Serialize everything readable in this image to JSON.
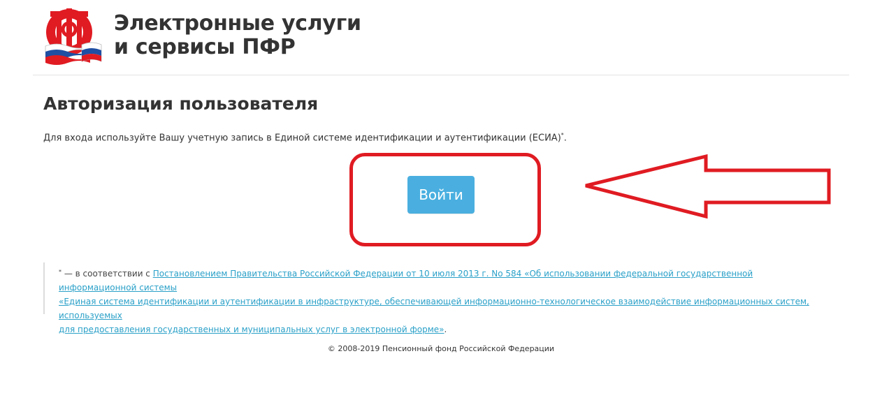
{
  "header": {
    "logo_alt": "ПФР",
    "title_line1": "Электронные услуги",
    "title_line2": "и сервисы ПФР"
  },
  "main": {
    "title": "Авторизация пользователя",
    "intro_text": "Для входа используйте Вашу учетную запись в Единой системе идентификации и аутентификации (ЕСИА)",
    "intro_mark": "*",
    "intro_end": ".",
    "login_button_label": "Войти"
  },
  "footnote": {
    "marker": "*",
    "prefix": " — в соответствии с ",
    "link_line1": "Постановлением Правительства Российской Федерации от 10 июля 2013 г. No 584 «Об использовании федеральной государственной информационной системы",
    "link_line2": "«Единая система идентификации и аутентификации в инфраструктуре, обеспечивающей информационно-технологическое взаимодействие информационных систем, используемых",
    "link_line3": "для предоставления государственных и муниципальных услуг в электронной форме»",
    "suffix": "."
  },
  "footer": {
    "copyright": "© 2008-2019 Пенсионный фонд Российской Федерации"
  },
  "colors": {
    "accent_button": "#4aafe0",
    "highlight_red": "#e01b22",
    "link": "#2aa0c8",
    "logo_red": "#e01b22",
    "flag_blue": "#1f4fa3"
  }
}
